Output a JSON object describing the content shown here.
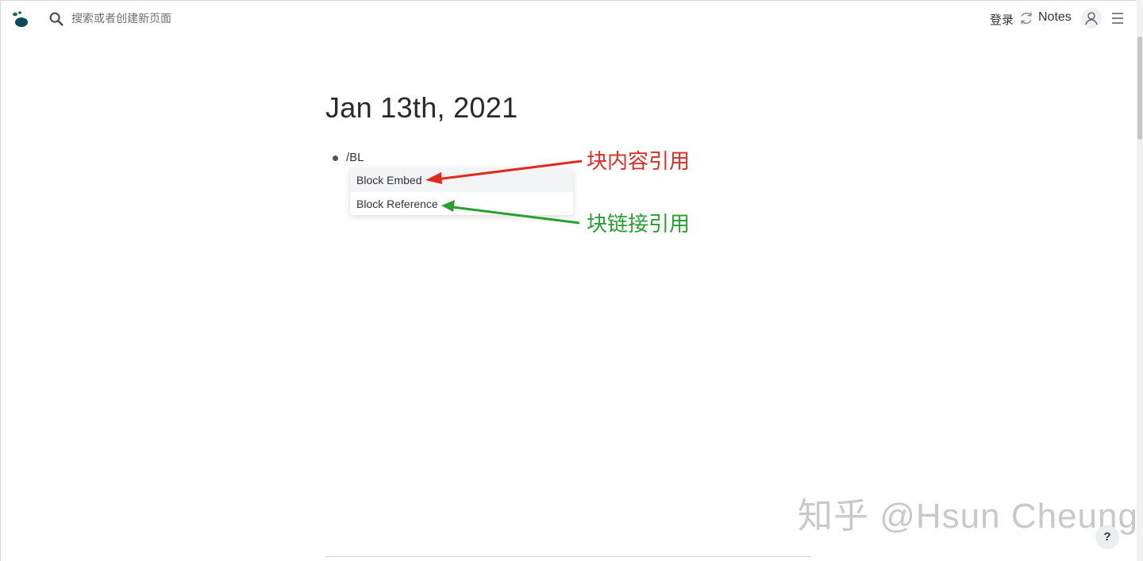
{
  "search": {
    "placeholder": "搜索或者创建新页面"
  },
  "header": {
    "login_label": "登录",
    "repo_name": "Notes",
    "icons": [
      "logseq-logo-icon",
      "search-icon",
      "sync-icon",
      "avatar-icon",
      "menu-icon"
    ]
  },
  "page": {
    "title": "Jan 13th, 2021",
    "block_text": "/BL"
  },
  "autocomplete": {
    "items": [
      {
        "label": "Block Embed",
        "active": true
      },
      {
        "label": "Block Reference",
        "active": false
      }
    ]
  },
  "annotations": {
    "embed_label": "块内容引用",
    "reference_label": "块链接引用",
    "embed_color": "#e02b20",
    "reference_color": "#27a12d"
  },
  "watermark": "知乎 @Hsun Cheung",
  "help_label": "?"
}
